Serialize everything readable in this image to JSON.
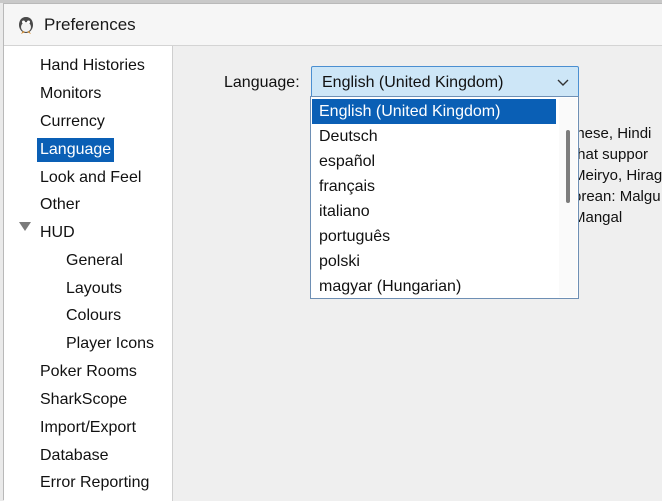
{
  "window": {
    "title": "Preferences"
  },
  "sidebar": {
    "items": [
      {
        "label": "Hand Histories"
      },
      {
        "label": "Monitors"
      },
      {
        "label": "Currency"
      },
      {
        "label": "Language"
      },
      {
        "label": "Look and Feel"
      },
      {
        "label": "Other"
      },
      {
        "label": "HUD"
      },
      {
        "label": "General"
      },
      {
        "label": "Layouts"
      },
      {
        "label": "Colours"
      },
      {
        "label": "Player Icons"
      },
      {
        "label": "Poker Rooms"
      },
      {
        "label": "SharkScope"
      },
      {
        "label": "Import/Export"
      },
      {
        "label": "Database"
      },
      {
        "label": "Error Reporting"
      }
    ],
    "selected": "Language"
  },
  "language": {
    "label": "Language:",
    "selected_value": "English (United Kingdom)",
    "options": [
      "English (United Kingdom)",
      "Deutsch",
      "español",
      "français",
      "italiano",
      "português",
      "polski",
      "magyar (Hungarian)"
    ]
  },
  "background_text": [
    "inese, Hindi",
    "that suppor",
    "Meiryo, Hirag",
    "orean: Malgu",
    "Mangal"
  ],
  "colors": {
    "selection": "#0a5fb5",
    "combo_bg": "#cde6f7"
  },
  "icons": {
    "app": "fish-icon",
    "combo": "chevron-down-icon",
    "tree": "triangle-down-icon"
  }
}
